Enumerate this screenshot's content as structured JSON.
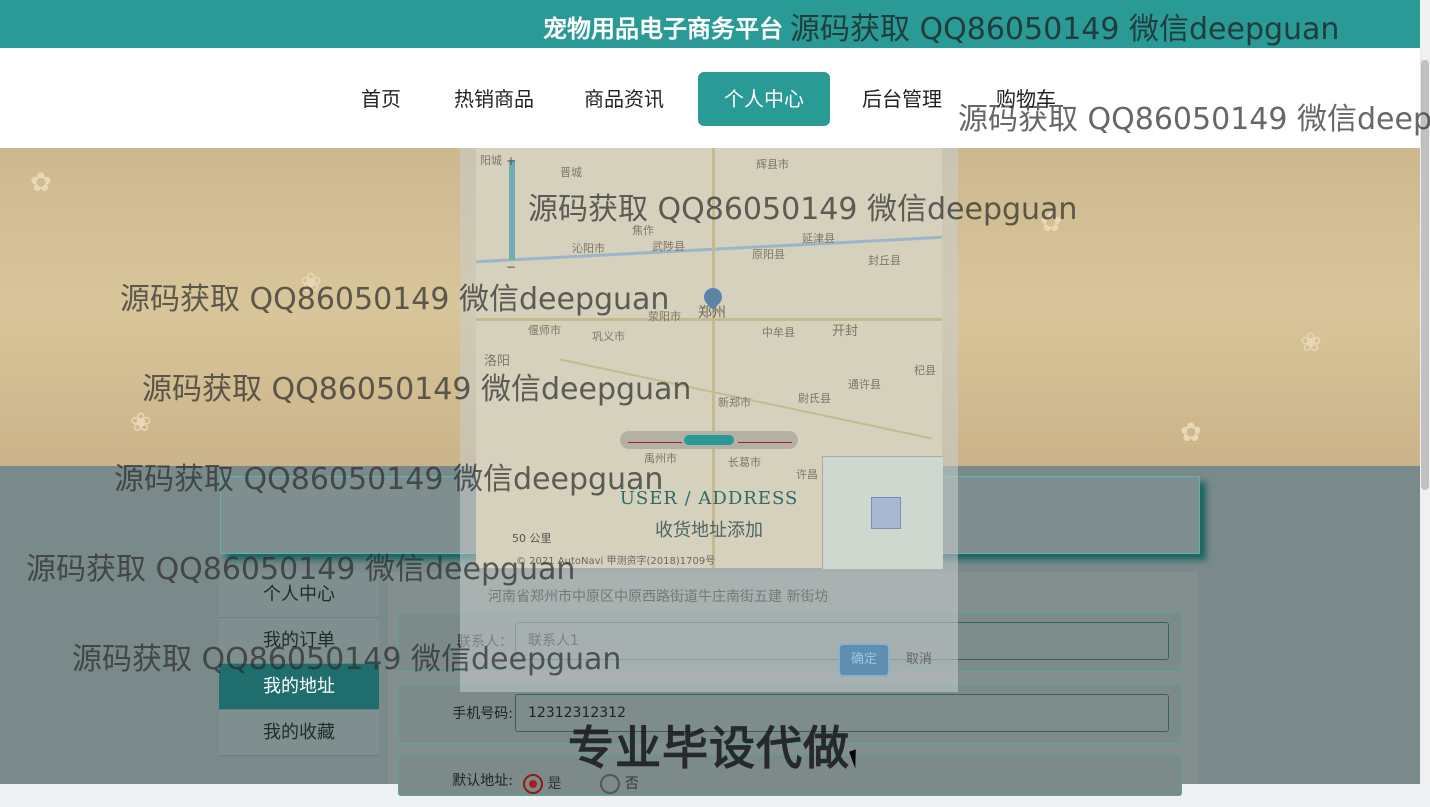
{
  "header": {
    "brand": "宠物用品电子商务平台",
    "accent": "#2a9a97"
  },
  "nav": {
    "items": [
      "首页",
      "热销商品",
      "商品资讯",
      "个人中心",
      "后台管理",
      "购物车"
    ],
    "active": "个人中心"
  },
  "section_title": {
    "en": "USER / ADDRESS",
    "zh": "收货地址添加"
  },
  "side_menu": {
    "items": [
      "个人中心",
      "我的订单",
      "我的地址",
      "我的收藏"
    ],
    "active": "我的地址"
  },
  "form": {
    "contact_label": "联系人：",
    "contact_value": "联系人1",
    "phone_label": "手机号码:",
    "phone_value": "12312312312",
    "default_label": "默认地址:",
    "opt_yes": "是",
    "opt_no": "否"
  },
  "map_dialog": {
    "cities": [
      "阳城",
      "晋城",
      "辉县市",
      "焦作",
      "沁阳市",
      "武陟县",
      "原阳县",
      "延津县",
      "封丘县",
      "郑州",
      "开封",
      "荥阳市",
      "中牟县",
      "偃师市",
      "巩义市",
      "洛阳",
      "新郑市",
      "尉氏县",
      "通许县",
      "杞县",
      "禹州市",
      "长葛市",
      "许昌"
    ],
    "scale": "50 公里",
    "copyright": "© 2021 AutoNavi 甲测资字(2018)1709号",
    "address": "河南省郑州市中原区中原西路街道牛庄南街五建 新街坊",
    "confirm": "确定",
    "cancel": "取消"
  },
  "watermarks": {
    "text": "源码获取 QQ86050149 微信deepguan",
    "promo": "专业毕设代做"
  }
}
